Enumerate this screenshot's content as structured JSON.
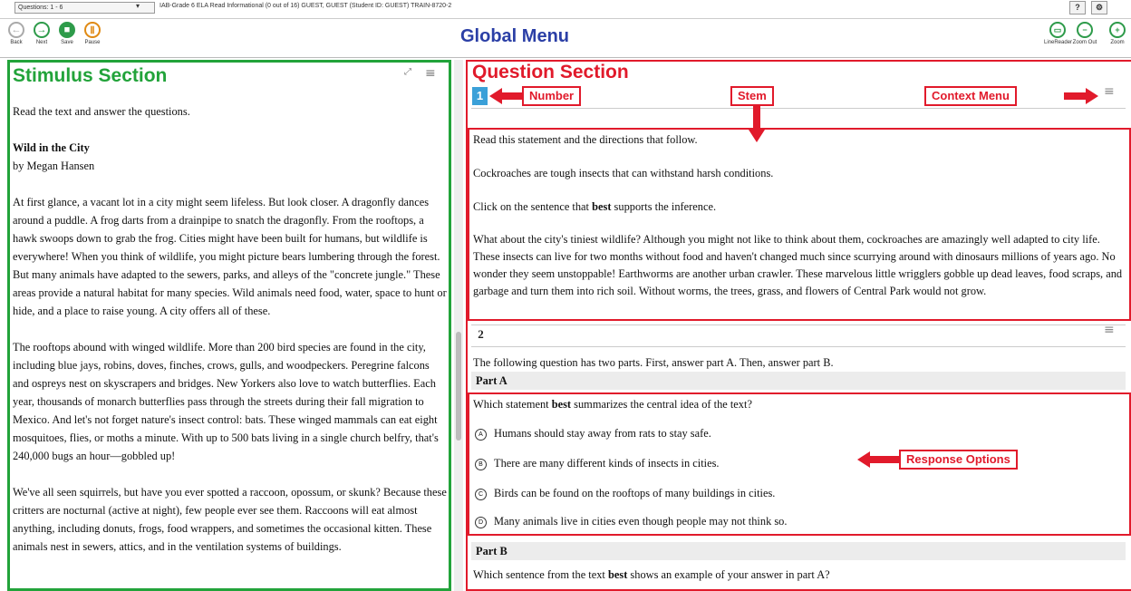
{
  "topbar": {
    "question_select": "Questions: 1 - 6",
    "test_info": "IAB-Grade 6 ELA Read Informational (0 out of 16)   GUEST, GUEST (Student ID: GUEST)   TRAIN-8720-2",
    "help_label": "?",
    "settings_label": "⚙"
  },
  "global_menu": {
    "title": "Global Menu",
    "buttons": [
      {
        "label": "Back",
        "icon": "back-arrow-icon",
        "glyph": "←"
      },
      {
        "label": "Next",
        "icon": "next-arrow-icon",
        "glyph": "→"
      },
      {
        "label": "Save",
        "icon": "save-icon",
        "glyph": "■"
      },
      {
        "label": "Pause",
        "icon": "pause-icon",
        "glyph": "Ⅱ"
      }
    ],
    "tools": [
      {
        "label": "LineReader",
        "icon": "line-reader-icon",
        "glyph": "▭"
      },
      {
        "label": "Zoom Out",
        "icon": "zoom-out-icon",
        "glyph": "−"
      },
      {
        "label": "Zoom",
        "icon": "zoom-in-icon",
        "glyph": "+"
      }
    ]
  },
  "stimulus": {
    "section_label": "Stimulus Section",
    "intro": "Read the text and answer the questions.",
    "article_title": "Wild in the City",
    "byline": "by Megan Hansen",
    "paragraphs": [
      "At first glance, a vacant lot in a city might seem lifeless. But look closer. A dragonfly dances around a puddle. A frog darts from a drainpipe to snatch the dragonfly. From the rooftops, a hawk swoops down to grab the frog. Cities might have been built for humans, but wildlife is everywhere! When you think of wildlife, you might picture bears lumbering through the forest. But many animals have adapted to the sewers, parks, and alleys of the \"concrete jungle.\" These areas provide a natural habitat for many species. Wild animals need food, water, space to hunt or hide, and a place to raise young. A city offers all of these.",
      "The rooftops abound with winged wildlife. More than 200 bird species are found in the city, including blue jays, robins, doves, finches, crows, gulls, and woodpeckers. Peregrine falcons and ospreys nest on skyscrapers and bridges. New Yorkers also love to watch butterflies. Each year, thousands of monarch butterflies pass through the streets during their fall migration to Mexico. And let's not forget nature's insect control: bats. These winged mammals can eat eight mosquitoes, flies, or moths a minute. With up to 500 bats living in a single church belfry, that's 240,000 bugs an hour—gobbled up!",
      "We've all seen squirrels, but have you ever spotted a raccoon, opossum, or skunk? Because these critters are nocturnal (active at night), few people ever see them. Raccoons will eat almost anything, including donuts, frogs, food wrappers, and sometimes the occasional kitten. These animals nest in sewers, attics, and in the ventilation systems of buildings."
    ]
  },
  "question_section": {
    "section_label": "Question Section",
    "q1": {
      "number": "1",
      "lines": [
        "Read this statement and the directions that follow.",
        "Cockroaches are tough insects that can withstand harsh conditions.",
        "What about the city's tiniest wildlife? Although you might not like to think about them, cockroaches are amazingly well adapted to city life. These insects can live for two months without food and haven't changed much since scurrying around with dinosaurs millions of years ago. No wonder they seem unstoppable! Earthworms are another urban crawler. These marvelous little wrigglers gobble up dead leaves, food scraps, and garbage and turn them into rich soil. Without worms, the trees, grass, and flowers of Central Park would not grow."
      ],
      "click_prefix": "Click on the sentence that ",
      "click_bold": "best",
      "click_suffix": " supports the inference."
    },
    "q2": {
      "number": "2",
      "intro": "The following question has two parts. First, answer part A. Then, answer part B.",
      "part_a_label": "Part A",
      "part_a_prefix": "Which statement ",
      "part_a_bold": "best",
      "part_a_suffix": " summarizes the central idea of the text?",
      "options": [
        {
          "letter": "A",
          "text": "Humans should stay away from rats to stay safe."
        },
        {
          "letter": "B",
          "text": "There are many different kinds of insects in cities."
        },
        {
          "letter": "C",
          "text": "Birds can be found on the rooftops of many buildings in cities."
        },
        {
          "letter": "D",
          "text": "Many animals live in cities even though people may not think so."
        }
      ],
      "part_b_label": "Part B",
      "part_b_prefix": "Which sentence from the text ",
      "part_b_bold": "best",
      "part_b_suffix": " shows an example of your answer in part A?"
    }
  },
  "annotations": {
    "number": "Number",
    "stem": "Stem",
    "context_menu": "Context Menu",
    "response_options": "Response Options"
  },
  "colors": {
    "stimulus_green": "#22a33a",
    "question_red": "#e11a2b",
    "title_blue": "#2b3fa6",
    "number_blue": "#3ba0d8"
  }
}
